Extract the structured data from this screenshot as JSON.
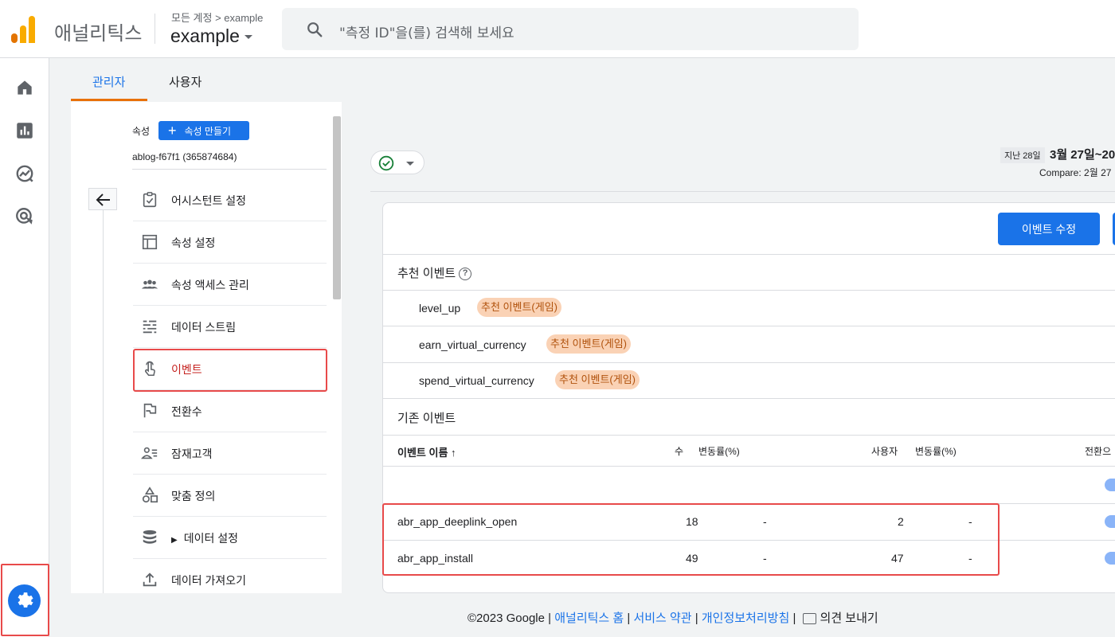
{
  "header": {
    "brand": "애널리틱스",
    "breadcrumb": "모든 계정 > example",
    "account": "example",
    "search_placeholder": "\"측정 ID\"을(를) 검색해 보세요",
    "colors": {
      "logo_orange": "#f9ab00",
      "logo_dark_orange": "#e37400"
    }
  },
  "rail": {
    "icons": [
      "home-icon",
      "reports-icon",
      "explore-icon",
      "advertising-icon"
    ],
    "settings_icon": "gear-icon"
  },
  "tabs": [
    {
      "label": "관리자",
      "active": true
    },
    {
      "label": "사용자",
      "active": false
    }
  ],
  "property": {
    "label": "속성",
    "create_button": "속성 만들기",
    "id": "ablog-f67f1 (365874684)",
    "menu": [
      {
        "label": "어시스턴트 설정",
        "icon": "checklist-icon"
      },
      {
        "label": "속성 설정",
        "icon": "layout-icon"
      },
      {
        "label": "속성 액세스 관리",
        "icon": "people-icon"
      },
      {
        "label": "데이터 스트림",
        "icon": "streams-icon"
      },
      {
        "label": "이벤트",
        "icon": "touch-icon",
        "active": true
      },
      {
        "label": "전환수",
        "icon": "flag-icon"
      },
      {
        "label": "잠재고객",
        "icon": "audience-icon"
      },
      {
        "label": "맞춤 정의",
        "icon": "shapes-icon"
      },
      {
        "label": "데이터 설정",
        "icon": "database-icon"
      },
      {
        "label": "데이터 가져오기",
        "icon": "upload-icon"
      }
    ]
  },
  "date": {
    "badge": "지난 28일",
    "range": "3월 27일~20",
    "compare": "Compare: 2월 27"
  },
  "events": {
    "edit_button": "이벤트 수정",
    "recommended_title": "추천 이벤트",
    "recommended": [
      {
        "name": "level_up",
        "tag": "추천 이벤트(게임)"
      },
      {
        "name": "earn_virtual_currency",
        "tag": "추천 이벤트(게임)"
      },
      {
        "name": "spend_virtual_currency",
        "tag": "추천 이벤트(게임)"
      }
    ],
    "existing_title": "기존 이벤트",
    "columns": {
      "name": "이벤트 이름",
      "count": "수",
      "count_change": "변동률(%)",
      "users": "사용자",
      "users_change": "변동률(%)",
      "conversion": "전환으"
    },
    "rows": [
      {
        "name": "abr_app_deeplink_open",
        "count": "18",
        "count_change": "-",
        "users": "2",
        "users_change": "-"
      },
      {
        "name": "abr_app_install",
        "count": "49",
        "count_change": "-",
        "users": "47",
        "users_change": "-"
      }
    ]
  },
  "footer": {
    "copyright": "©2023 Google",
    "sep": "|",
    "links": [
      "애널리틱스 홈",
      "서비스 약관",
      "개인정보처리방침"
    ],
    "feedback": "의견 보내기"
  }
}
